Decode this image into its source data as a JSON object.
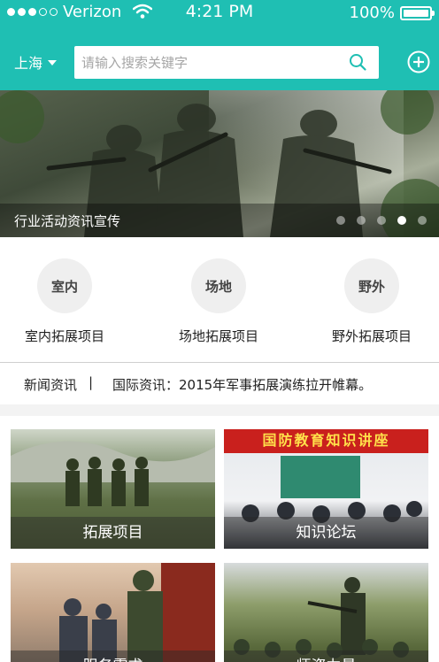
{
  "status_bar": {
    "carrier": "Verizon",
    "time": "4:21 PM",
    "battery": "100%"
  },
  "nav": {
    "city": "上海",
    "search_placeholder": "请输入搜索关键字"
  },
  "banner": {
    "caption": "行业活动资讯宣传",
    "page_count": 5,
    "active_page": 4
  },
  "categories": [
    {
      "icon_text": "室内",
      "label": "室内拓展项目"
    },
    {
      "icon_text": "场地",
      "label": "场地拓展项目"
    },
    {
      "icon_text": "野外",
      "label": "野外拓展项目"
    }
  ],
  "news": {
    "tag": "新闻资讯",
    "separator": "|",
    "headline": "国际资讯：2015年军事拓展演练拉开帷幕。"
  },
  "tiles": [
    {
      "label": "拓展项目"
    },
    {
      "label": "知识论坛",
      "board_text": "国防教育知识讲座"
    },
    {
      "label": "服务需求"
    },
    {
      "label": "师资力量"
    }
  ],
  "colors": {
    "primary": "#1fbfb3"
  }
}
